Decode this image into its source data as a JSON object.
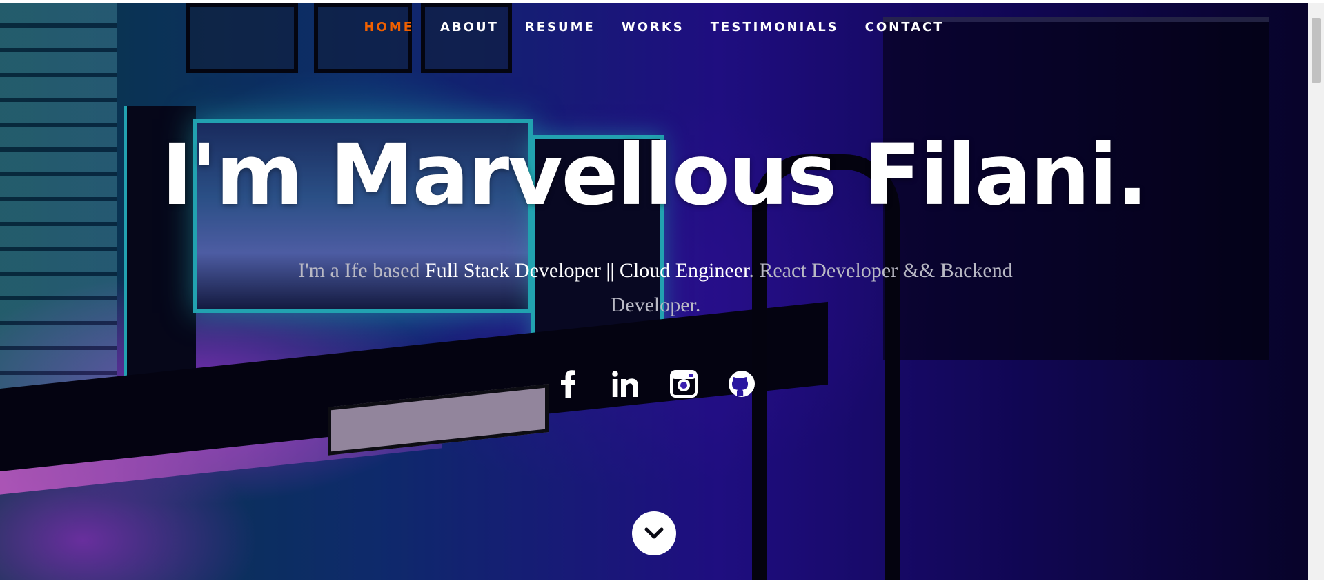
{
  "nav": {
    "items": [
      {
        "label": "HOME",
        "active": true
      },
      {
        "label": "ABOUT"
      },
      {
        "label": "RESUME"
      },
      {
        "label": "WORKS"
      },
      {
        "label": "TESTIMONIALS"
      },
      {
        "label": "CONTACT"
      }
    ],
    "active_color": "#f06000"
  },
  "hero": {
    "headline": "I'm Marvellous Filani.",
    "sub_part1": "I'm a Ife based ",
    "sub_highlight": "Full Stack Developer || Cloud Engineer",
    "sub_part2": ". React Developer && Backend Developer."
  },
  "social": {
    "icons": [
      "facebook-icon",
      "linkedin-icon",
      "instagram-icon",
      "github-icon"
    ]
  },
  "scroll_down": {
    "icon": "chevron-down-icon"
  }
}
